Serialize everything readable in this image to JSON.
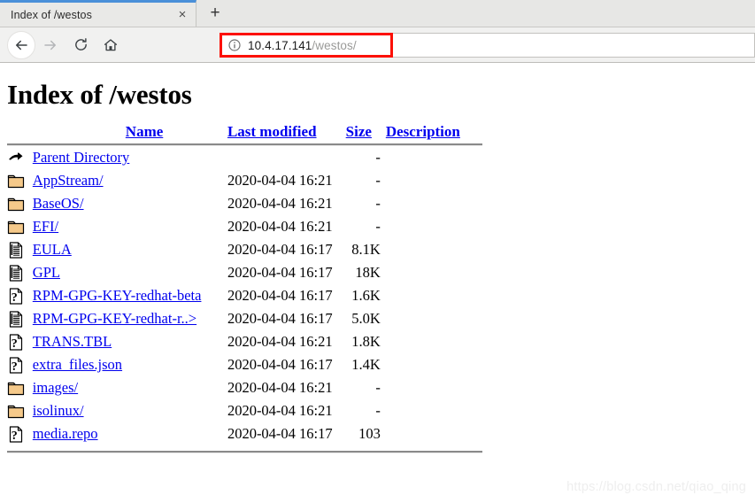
{
  "browser": {
    "tab": {
      "title": "Index of /westos",
      "close_label": "×"
    },
    "new_tab_label": "+",
    "nav": {
      "back_label": "Back",
      "forward_label": "Forward",
      "reload_label": "Reload",
      "home_label": "Home"
    },
    "url": {
      "host": "10.4.17.141",
      "path": "/westos/",
      "security_icon": "info-icon",
      "highlight_color": "#fc1005"
    }
  },
  "page": {
    "title": "Index of /westos",
    "columns": {
      "name": "Name",
      "last_modified": "Last modified",
      "size": "Size",
      "description": "Description"
    },
    "rows": [
      {
        "icon": "back-icon",
        "name": "Parent Directory",
        "date": "",
        "size": "-",
        "desc": ""
      },
      {
        "icon": "folder-icon",
        "name": "AppStream/",
        "date": "2020-04-04 16:21",
        "size": "-",
        "desc": ""
      },
      {
        "icon": "folder-icon",
        "name": "BaseOS/",
        "date": "2020-04-04 16:21",
        "size": "-",
        "desc": ""
      },
      {
        "icon": "folder-icon",
        "name": "EFI/",
        "date": "2020-04-04 16:21",
        "size": "-",
        "desc": ""
      },
      {
        "icon": "text-icon",
        "name": "EULA",
        "date": "2020-04-04 16:17",
        "size": "8.1K",
        "desc": ""
      },
      {
        "icon": "text-icon",
        "name": "GPL",
        "date": "2020-04-04 16:17",
        "size": "18K",
        "desc": ""
      },
      {
        "icon": "unknown-icon",
        "name": "RPM-GPG-KEY-redhat-beta",
        "date": "2020-04-04 16:17",
        "size": "1.6K",
        "desc": ""
      },
      {
        "icon": "text-icon",
        "name": "RPM-GPG-KEY-redhat-r..>",
        "date": "2020-04-04 16:17",
        "size": "5.0K",
        "desc": ""
      },
      {
        "icon": "unknown-icon",
        "name": "TRANS.TBL",
        "date": "2020-04-04 16:21",
        "size": "1.8K",
        "desc": ""
      },
      {
        "icon": "unknown-icon",
        "name": "extra_files.json",
        "date": "2020-04-04 16:17",
        "size": "1.4K",
        "desc": ""
      },
      {
        "icon": "folder-icon",
        "name": "images/",
        "date": "2020-04-04 16:21",
        "size": "-",
        "desc": ""
      },
      {
        "icon": "folder-icon",
        "name": "isolinux/",
        "date": "2020-04-04 16:21",
        "size": "-",
        "desc": ""
      },
      {
        "icon": "unknown-icon",
        "name": "media.repo",
        "date": "2020-04-04 16:17",
        "size": "103",
        "desc": ""
      }
    ],
    "link_color": "#0000ee",
    "folder_color": "#f5c98a"
  },
  "watermark": "https://blog.csdn.net/qiao_qing"
}
